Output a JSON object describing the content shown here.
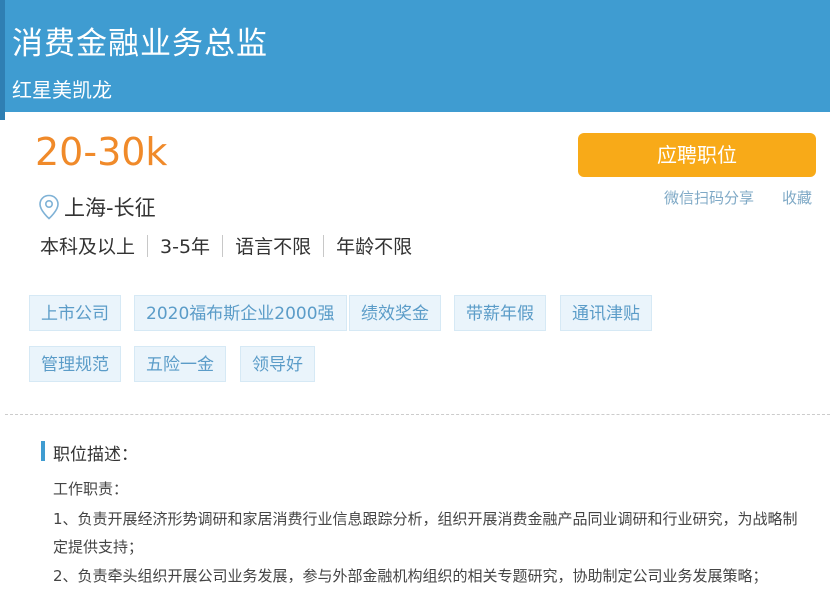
{
  "header": {
    "job_title": "消费金融业务总监",
    "company": "红星美凯龙"
  },
  "salary": "20-30k",
  "actions": {
    "apply_label": "应聘职位",
    "share_label": "微信扫码分享",
    "favorite_label": "收藏"
  },
  "location": {
    "icon": "map-pin-icon",
    "text": "上海-长征"
  },
  "requirements": [
    "本科及以上",
    "3-5年",
    "语言不限",
    "年龄不限"
  ],
  "tags": [
    "上市公司",
    "2020福布斯企业2000强",
    "绩效奖金",
    "带薪年假",
    "通讯津贴",
    "管理规范",
    "五险一金",
    "领导好"
  ],
  "description": {
    "title": "职位描述：",
    "lines": [
      "工作职责：",
      "1、负责开展经济形势调研和家居消费行业信息跟踪分析，组织开展消费金融产品同业调研和行业研究，为战略制",
      "定提供支持；",
      "2、负责牵头组织开展公司业务发展，参与外部金融机构组织的相关专题研究，协助制定公司业务发展策略；"
    ]
  },
  "colors": {
    "header_bg": "#3f9cd1",
    "salary": "#f08a2a",
    "apply_button": "#f8aa18",
    "tag_text": "#5b9cc8"
  }
}
